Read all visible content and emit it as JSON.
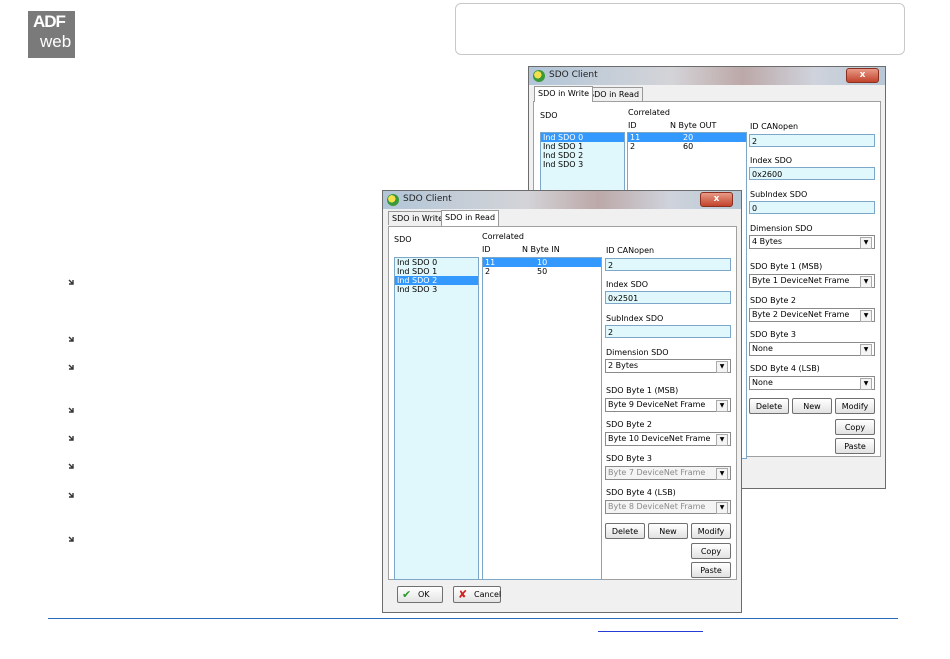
{
  "logo": {
    "line1": "ADF",
    "line2": "web"
  },
  "back": {
    "title": "SDO Client",
    "close": "x",
    "tabs": [
      "SDO in Write",
      "SDO in Read"
    ],
    "sdo_label": "SDO",
    "correlated_label": "Correlated",
    "col_id": "ID",
    "col_n": "N Byte OUT",
    "sdo_items": [
      "Ind SDO 0",
      "Ind SDO 1",
      "Ind SDO 2",
      "Ind SDO 3"
    ],
    "rows": [
      {
        "id": "11",
        "n": "20"
      },
      {
        "id": "2",
        "n": "60"
      }
    ],
    "id_canopen_label": "ID CANopen",
    "id_canopen": "2",
    "index_label": "Index SDO",
    "index": "0x2600",
    "subindex_label": "SubIndex SDO",
    "subindex": "0",
    "dimension_label": "Dimension SDO",
    "dimension": "4 Bytes",
    "byte1_label": "SDO Byte 1 (MSB)",
    "byte1": "Byte 1 DeviceNet Frame",
    "byte2_label": "SDO Byte 2",
    "byte2": "Byte 2 DeviceNet Frame",
    "byte3_label": "SDO Byte 3",
    "byte3": "None",
    "byte4_label": "SDO Byte 4 (LSB)",
    "byte4": "None",
    "delete": "Delete",
    "new": "New",
    "modify": "Modify",
    "copy": "Copy",
    "paste": "Paste"
  },
  "front": {
    "title": "SDO Client",
    "close": "x",
    "tabs": [
      "SDO in Write",
      "SDO in Read"
    ],
    "sdo_label": "SDO",
    "correlated_label": "Correlated",
    "col_id": "ID",
    "col_n": "N Byte IN",
    "sdo_items": [
      "Ind SDO 0",
      "Ind SDO 1",
      "Ind SDO 2",
      "Ind SDO 3"
    ],
    "rows": [
      {
        "id": "11",
        "n": "10"
      },
      {
        "id": "2",
        "n": "50"
      }
    ],
    "id_canopen_label": "ID CANopen",
    "id_canopen": "2",
    "index_label": "Index SDO",
    "index": "0x2501",
    "subindex_label": "SubIndex SDO",
    "subindex": "2",
    "dimension_label": "Dimension SDO",
    "dimension": "2 Bytes",
    "byte1_label": "SDO Byte 1 (MSB)",
    "byte1": "Byte 9 DeviceNet Frame",
    "byte2_label": "SDO Byte 2",
    "byte2": "Byte 10 DeviceNet Frame",
    "byte3_label": "SDO Byte 3",
    "byte3": "Byte 7 DeviceNet Frame",
    "byte4_label": "SDO Byte 4 (LSB)",
    "byte4": "Byte 8 DeviceNet Frame",
    "delete": "Delete",
    "new": "New",
    "modify": "Modify",
    "copy": "Copy",
    "paste": "Paste",
    "ok": "OK",
    "cancel": "Cancel"
  }
}
